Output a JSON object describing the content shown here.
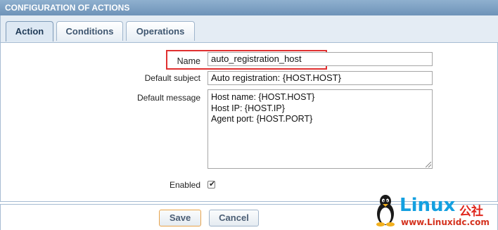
{
  "header": {
    "title": "CONFIGURATION OF ACTIONS"
  },
  "tabs": [
    {
      "label": "Action",
      "active": true
    },
    {
      "label": "Conditions",
      "active": false
    },
    {
      "label": "Operations",
      "active": false
    }
  ],
  "form": {
    "name": {
      "label": "Name",
      "value": "auto_registration_host"
    },
    "subject": {
      "label": "Default subject",
      "value": "Auto registration: {HOST.HOST}"
    },
    "message": {
      "label": "Default message",
      "lines": [
        "Host name: {HOST.HOST}",
        "Host IP: {HOST.IP}",
        "Agent port: {HOST.PORT}"
      ]
    },
    "enabled": {
      "label": "Enabled",
      "checked": true
    }
  },
  "buttons": {
    "save": "Save",
    "cancel": "Cancel"
  },
  "watermark": {
    "brand": "Linux",
    "cn": "公社",
    "url": "www.Linuxidc.com"
  },
  "colors": {
    "highlight": "#e03030",
    "header": "#7a9cc0",
    "save_border": "#e8a34a"
  }
}
